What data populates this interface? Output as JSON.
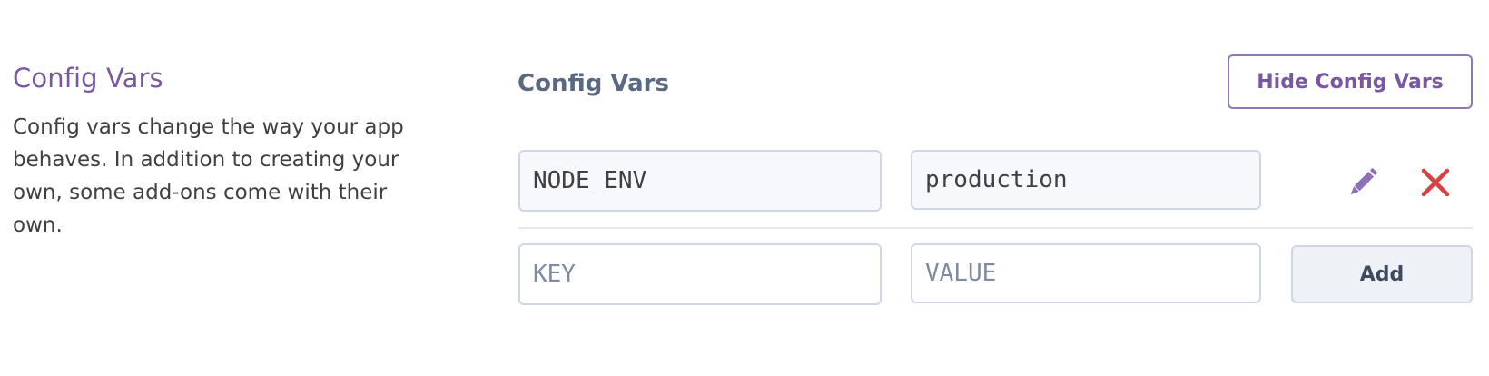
{
  "section": {
    "heading": "Config Vars",
    "description": "Config vars change the way your app behaves. In addition to creating your own, some add-ons come with their own."
  },
  "config_vars": {
    "title": "Config Vars",
    "hide_button_label": "Hide Config Vars",
    "entries": [
      {
        "key": "NODE_ENV",
        "value": "production"
      }
    ],
    "new_entry": {
      "key_placeholder": "KEY",
      "value_placeholder": "VALUE",
      "add_button_label": "Add"
    },
    "icons": {
      "edit": "pencil-icon",
      "delete": "close-icon"
    }
  },
  "colors": {
    "accent_purple": "#79589f",
    "delete_red": "#d64242",
    "title_slate": "#596981",
    "border": "#cfd7e6"
  }
}
